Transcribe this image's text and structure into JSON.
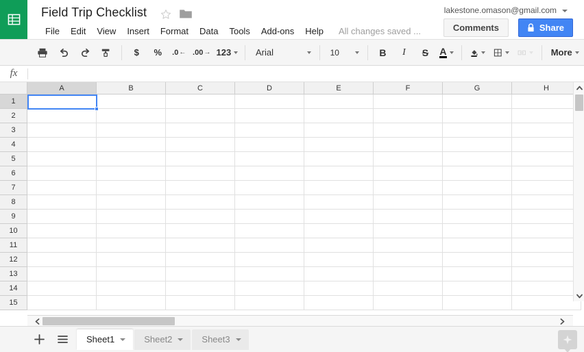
{
  "app": {
    "name": "Google Sheets",
    "logo_icon": "sheets-grid-icon",
    "brand_color": "#0f9d58",
    "accent_color": "#4285f4"
  },
  "header": {
    "doc_title": "Field Trip Checklist",
    "star_icon": "star-outline-icon",
    "folder_icon": "folder-icon",
    "account_email": "lakestone.omason@gmail.com",
    "account_caret_icon": "chevron-down-icon",
    "comments_label": "Comments",
    "share_label": "Share",
    "share_lock_icon": "lock-icon"
  },
  "menubar": {
    "items": [
      {
        "label": "File"
      },
      {
        "label": "Edit"
      },
      {
        "label": "View"
      },
      {
        "label": "Insert"
      },
      {
        "label": "Format"
      },
      {
        "label": "Data"
      },
      {
        "label": "Tools"
      },
      {
        "label": "Add-ons"
      },
      {
        "label": "Help"
      }
    ],
    "save_status": "All changes saved ..."
  },
  "toolbar": {
    "print_icon": "print-icon",
    "undo_icon": "undo-icon",
    "redo_icon": "redo-icon",
    "paint_format_icon": "paint-format-icon",
    "currency_label": "$",
    "percent_label": "%",
    "decrease_decimal_label": ".0",
    "increase_decimal_label": ".00",
    "number_format_label": "123",
    "font_family": "Arial",
    "font_size": "10",
    "bold_label": "B",
    "italic_label": "I",
    "strikethrough_label": "S",
    "text_color_label": "A",
    "fill_color_icon": "fill-color-icon",
    "borders_icon": "borders-icon",
    "merge_cells_icon": "merge-cells-icon",
    "more_label": "More"
  },
  "formula_bar": {
    "fx_label": "fx",
    "value": "",
    "placeholder": ""
  },
  "grid": {
    "columns": [
      "A",
      "B",
      "C",
      "D",
      "E",
      "F",
      "G",
      "H"
    ],
    "rows": [
      "1",
      "2",
      "3",
      "4",
      "5",
      "6",
      "7",
      "8",
      "9",
      "10",
      "11",
      "12",
      "13",
      "14",
      "15"
    ],
    "selected_cell": "A1",
    "selected_column": "A",
    "selected_row": "1",
    "cell_values": [
      [
        "",
        "",
        "",
        "",
        "",
        "",
        "",
        ""
      ],
      [
        "",
        "",
        "",
        "",
        "",
        "",
        "",
        ""
      ],
      [
        "",
        "",
        "",
        "",
        "",
        "",
        "",
        ""
      ],
      [
        "",
        "",
        "",
        "",
        "",
        "",
        "",
        ""
      ],
      [
        "",
        "",
        "",
        "",
        "",
        "",
        "",
        ""
      ],
      [
        "",
        "",
        "",
        "",
        "",
        "",
        "",
        ""
      ],
      [
        "",
        "",
        "",
        "",
        "",
        "",
        "",
        ""
      ],
      [
        "",
        "",
        "",
        "",
        "",
        "",
        "",
        ""
      ],
      [
        "",
        "",
        "",
        "",
        "",
        "",
        "",
        ""
      ],
      [
        "",
        "",
        "",
        "",
        "",
        "",
        "",
        ""
      ],
      [
        "",
        "",
        "",
        "",
        "",
        "",
        "",
        ""
      ],
      [
        "",
        "",
        "",
        "",
        "",
        "",
        "",
        ""
      ],
      [
        "",
        "",
        "",
        "",
        "",
        "",
        "",
        ""
      ],
      [
        "",
        "",
        "",
        "",
        "",
        "",
        "",
        ""
      ],
      [
        "",
        "",
        "",
        "",
        "",
        "",
        "",
        ""
      ]
    ]
  },
  "scrollbars": {
    "v_up_icon": "chevron-up-icon",
    "v_down_icon": "chevron-down-icon",
    "h_left_icon": "chevron-left-icon",
    "h_right_icon": "chevron-right-icon"
  },
  "sheetbar": {
    "add_sheet_icon": "plus-icon",
    "all_sheets_icon": "hamburger-icon",
    "tabs": [
      {
        "label": "Sheet1",
        "active": true
      },
      {
        "label": "Sheet2",
        "active": false
      },
      {
        "label": "Sheet3",
        "active": false
      }
    ],
    "explore_icon": "explore-star-icon"
  }
}
